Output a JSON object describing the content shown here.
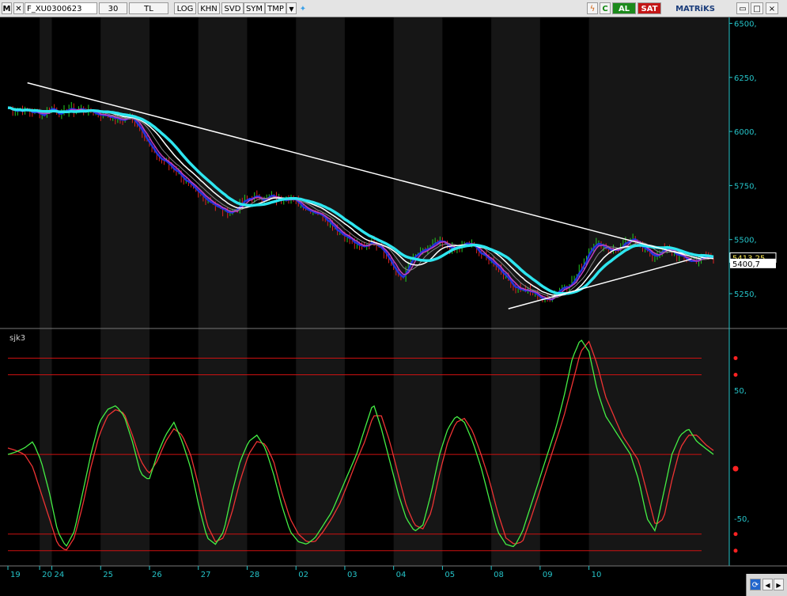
{
  "toolbar": {
    "symbol": "F_XU0300623",
    "period": "30",
    "currency": "TL",
    "buttons": [
      "LOG",
      "KHN",
      "SVD",
      "SYM",
      "TMP"
    ],
    "buy_label": "AL",
    "sell_label": "SAT",
    "brand": "MATRiKS"
  },
  "indicator": {
    "name": "sjk3"
  },
  "price_labels": {
    "last": "5413,25",
    "prev": "5400,7"
  },
  "colors": {
    "background": "#000000",
    "band_dark": "#161616",
    "axis": "#25c3c8",
    "up": "#22cc22",
    "down": "#dd2222",
    "trend": "#ffffff",
    "ma_cyan": "#2ee6f0",
    "ma_blue": "#2233dd",
    "ma_magenta": "#c040c0",
    "osc_green": "#44ee44",
    "osc_red": "#ee3333",
    "level": "#cc1111"
  },
  "chart_data": [
    {
      "type": "line",
      "title": "",
      "y_ticks": [
        "6500,",
        "6250,",
        "6000,",
        "5750,",
        "5500,",
        "5250,"
      ],
      "ylim": [
        5100,
        6520
      ],
      "x_ticks": [
        "19",
        "20",
        "24",
        "25",
        "26",
        "27",
        "28",
        "02",
        "03",
        "04",
        "05",
        "08",
        "09",
        "10"
      ],
      "x_tick_index": [
        0,
        13,
        18,
        38,
        58,
        78,
        98,
        118,
        138,
        158,
        178,
        198,
        218,
        238
      ],
      "trendlines": [
        {
          "from": {
            "i": 8,
            "y": 6225
          },
          "to": {
            "i": 284,
            "y": 5410
          }
        },
        {
          "from": {
            "i": 205,
            "y": 5180
          },
          "to": {
            "i": 280,
            "y": 5410
          }
        }
      ],
      "close": [
        6110,
        6105,
        6100,
        6102,
        6095,
        6100,
        6092,
        6085,
        6090,
        6075,
        6085,
        6100,
        6115,
        6090,
        6085,
        6080,
        6100,
        6110,
        6095,
        6100,
        6105,
        6100,
        6095,
        6090,
        6085,
        6080,
        6075,
        6078,
        6070,
        6060,
        6055,
        6050,
        6060,
        6070,
        6055,
        6040,
        6020,
        5990,
        5960,
        5920,
        5895,
        5880,
        5870,
        5860,
        5840,
        5830,
        5820,
        5800,
        5780,
        5760,
        5740,
        5720,
        5710,
        5700,
        5690,
        5680,
        5670,
        5650,
        5640,
        5635,
        5625,
        5630,
        5640,
        5650,
        5670,
        5680,
        5690,
        5700,
        5695,
        5690,
        5690,
        5695,
        5700,
        5690,
        5685,
        5690,
        5700,
        5695,
        5680,
        5670,
        5660,
        5650,
        5640,
        5635,
        5630,
        5620,
        5610,
        5600,
        5580,
        5560,
        5545,
        5530,
        5520,
        5510,
        5490,
        5475,
        5465,
        5465,
        5480,
        5490,
        5490,
        5480,
        5470,
        5440,
        5410,
        5380,
        5345,
        5325,
        5330,
        5360,
        5400,
        5420,
        5430,
        5440,
        5450,
        5460,
        5470,
        5480,
        5490,
        5480,
        5470,
        5460,
        5455,
        5460,
        5470,
        5480,
        5480,
        5470,
        5460,
        5440,
        5420,
        5410,
        5400,
        5390,
        5370,
        5350,
        5330,
        5310,
        5290,
        5280,
        5270,
        5265,
        5260,
        5255,
        5250,
        5240,
        5225,
        5220,
        5225,
        5240,
        5260,
        5275,
        5285,
        5290,
        5300,
        5320,
        5350,
        5380,
        5420,
        5460,
        5480,
        5480,
        5475,
        5470,
        5460,
        5455,
        5450,
        5455,
        5470,
        5480,
        5490,
        5500,
        5490,
        5480,
        5460,
        5440,
        5420,
        5430,
        5440,
        5450,
        5455,
        5450,
        5440,
        5430,
        5420,
        5410,
        5405,
        5400,
        5405,
        5410,
        5415,
        5420,
        5418,
        5413
      ]
    },
    {
      "type": "line",
      "title": "",
      "y_ticks": [
        "50,",
        "-50,"
      ],
      "ylim": [
        -85,
        95
      ],
      "levels": [
        75,
        62,
        0,
        -62,
        -75
      ],
      "series": [
        {
          "values": [
            0,
            2,
            5,
            10,
            -5,
            -30,
            -60,
            -72,
            -60,
            -30,
            0,
            25,
            35,
            38,
            30,
            10,
            -15,
            -20,
            0,
            15,
            25,
            10,
            -10,
            -40,
            -65,
            -70,
            -60,
            -30,
            -5,
            10,
            15,
            5,
            -15,
            -40,
            -60,
            -68,
            -70,
            -65,
            -55,
            -45,
            -30,
            -15,
            0,
            20,
            40,
            20,
            -5,
            -30,
            -50,
            -60,
            -55,
            -30,
            0,
            20,
            30,
            25,
            10,
            -10,
            -35,
            -60,
            -70,
            -72,
            -60,
            -40,
            -20,
            0,
            20,
            45,
            75,
            90,
            80,
            50,
            30,
            20,
            10,
            0,
            -20,
            -50,
            -60,
            -30,
            0,
            15,
            20,
            10,
            5,
            0
          ]
        },
        {
          "values": [
            5,
            3,
            0,
            -10,
            -30,
            -50,
            -70,
            -75,
            -65,
            -40,
            -10,
            15,
            30,
            35,
            32,
            15,
            -5,
            -15,
            -5,
            10,
            20,
            15,
            0,
            -25,
            -55,
            -68,
            -65,
            -45,
            -20,
            0,
            10,
            8,
            -5,
            -30,
            -50,
            -62,
            -68,
            -68,
            -60,
            -50,
            -38,
            -22,
            -5,
            10,
            30,
            30,
            10,
            -15,
            -40,
            -55,
            -58,
            -45,
            -15,
            10,
            25,
            28,
            18,
            0,
            -20,
            -45,
            -65,
            -70,
            -68,
            -50,
            -30,
            -10,
            10,
            30,
            55,
            80,
            88,
            70,
            45,
            30,
            15,
            5,
            -5,
            -30,
            -55,
            -50,
            -20,
            5,
            15,
            15,
            8,
            3
          ]
        }
      ]
    }
  ]
}
